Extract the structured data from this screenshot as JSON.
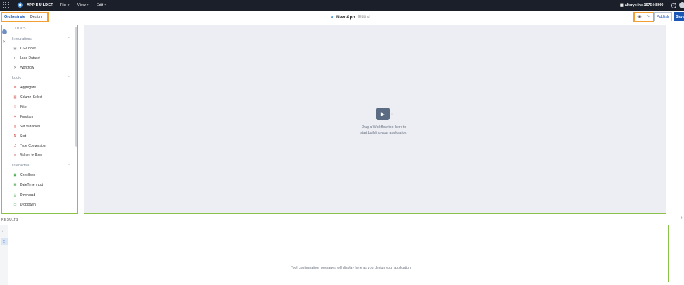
{
  "topbar": {
    "app_name": "APP BUILDER",
    "menus": [
      {
        "label": "File"
      },
      {
        "label": "View"
      },
      {
        "label": "Edit"
      }
    ],
    "org_name": "alteryx-inc-1676448000",
    "help_symbol": "?"
  },
  "subbar": {
    "tabs": [
      {
        "label": "Orchestrate",
        "active": true
      },
      {
        "label": "Design",
        "active": false
      }
    ],
    "title": "New App",
    "status": "(Editing)",
    "publish_label": "Publish",
    "save_label": "Save"
  },
  "toolbox": {
    "header": "TOOLS",
    "sections": [
      {
        "label": "Integrations",
        "tools": [
          {
            "label": "CSV Input",
            "icon": "csv-input-icon"
          },
          {
            "label": "Load Dataset",
            "icon": "load-dataset-icon"
          },
          {
            "label": "Workflow",
            "icon": "workflow-icon"
          }
        ]
      },
      {
        "label": "Logic",
        "tools": [
          {
            "label": "Aggregate",
            "icon": "aggregate-icon"
          },
          {
            "label": "Column Select",
            "icon": "column-select-icon"
          },
          {
            "label": "Filter",
            "icon": "filter-icon"
          },
          {
            "label": "Function",
            "icon": "function-icon"
          },
          {
            "label": "Set Variables",
            "icon": "set-variables-icon"
          },
          {
            "label": "Sort",
            "icon": "sort-icon"
          },
          {
            "label": "Type Conversion",
            "icon": "type-conversion-icon"
          },
          {
            "label": "Values to Row",
            "icon": "values-to-row-icon"
          }
        ]
      },
      {
        "label": "Interactive",
        "tools": [
          {
            "label": "Checkbox",
            "icon": "checkbox-icon"
          },
          {
            "label": "DateTime Input",
            "icon": "datetime-input-icon"
          },
          {
            "label": "Download",
            "icon": "download-icon"
          },
          {
            "label": "Dropdown",
            "icon": "dropdown-icon"
          }
        ]
      }
    ]
  },
  "canvas": {
    "hint_line1": "Drag a Workflow tool here to",
    "hint_line2": "start building your application."
  },
  "results": {
    "label": "RESULTS",
    "message": "Tool configuration messages will display here as you design your application."
  },
  "colors": {
    "topbar_bg": "#1b1f2a",
    "accent_blue": "#1a57b7",
    "highlight_orange": "#f0a035",
    "panel_green": "#8bc34a",
    "canvas_bg": "#eceef3"
  }
}
